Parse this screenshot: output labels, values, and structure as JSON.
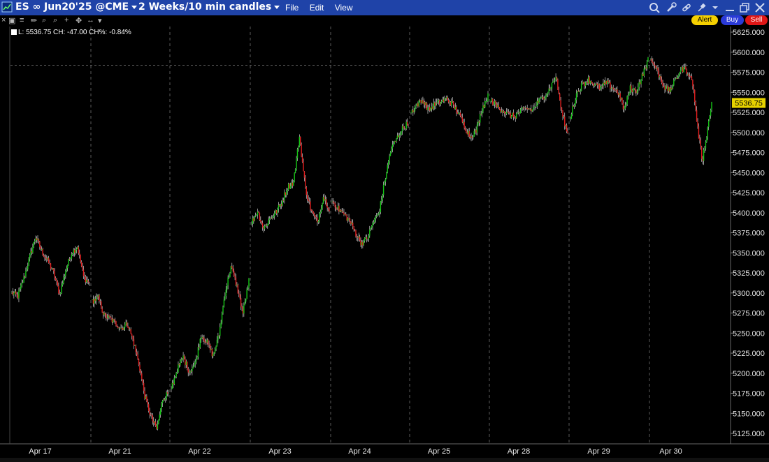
{
  "window": {
    "symbol": "ES ∞ Jun20'25 @CME",
    "timeframe": "2 Weeks/10 min candles",
    "menu": [
      "File",
      "Edit",
      "View"
    ]
  },
  "toolbar": {
    "alert_label": "Alert",
    "buy_label": "Buy",
    "sell_label": "Sell",
    "icons": [
      "crosshair-icon",
      "wrench-icon",
      "link-icon",
      "pin-icon",
      "minimize-icon",
      "restore-icon",
      "close-icon"
    ]
  },
  "readout": "L: 5536.75 CH: -47.00 CH%: -0.84%",
  "colors": {
    "up": "#14c814",
    "down": "#e41e1e",
    "background": "#000000",
    "grid": "#5a5a5a",
    "last_price_tag": "#e6d200"
  },
  "chart_data": {
    "type": "candlestick",
    "ylim": [
      5112,
      5632
    ],
    "y_ticks": [
      5125,
      5150,
      5175,
      5200,
      5225,
      5250,
      5275,
      5300,
      5325,
      5350,
      5375,
      5400,
      5425,
      5450,
      5475,
      5500,
      5525,
      5550,
      5575,
      5600,
      5625
    ],
    "x_labels": [
      "Apr 17",
      "Apr 21",
      "Apr 22",
      "Apr 23",
      "Apr 24",
      "Apr 25",
      "Apr 28",
      "Apr 29",
      "Apr 30"
    ],
    "last_price": 5536.75,
    "prev_close_reference": 5583.75,
    "sessions": [
      {
        "date": "Apr 17",
        "path": [
          5300,
          5296,
          5318,
          5345,
          5370,
          5352,
          5340,
          5325,
          5298,
          5328,
          5350,
          5358,
          5320,
          5312
        ]
      },
      {
        "date": "Apr 21",
        "path": [
          5290,
          5294,
          5272,
          5268,
          5262,
          5256,
          5262,
          5240,
          5210,
          5170,
          5146,
          5130,
          5168,
          5176
        ]
      },
      {
        "date": "Apr 22",
        "path": [
          5182,
          5205,
          5220,
          5202,
          5212,
          5248,
          5238,
          5222,
          5248,
          5300,
          5333,
          5308,
          5275,
          5315
        ]
      },
      {
        "date": "Apr 23",
        "path": [
          5388,
          5402,
          5380,
          5392,
          5400,
          5412,
          5432,
          5438,
          5495,
          5430,
          5402,
          5388,
          5420,
          5405
        ]
      },
      {
        "date": "Apr 24",
        "path": [
          5415,
          5405,
          5398,
          5390,
          5375,
          5362,
          5368,
          5388,
          5400,
          5440,
          5478,
          5492,
          5505,
          5512
        ]
      },
      {
        "date": "Apr 25",
        "path": [
          5525,
          5535,
          5540,
          5528,
          5535,
          5538,
          5542,
          5535,
          5524,
          5508,
          5495,
          5502,
          5530,
          5545
        ]
      },
      {
        "date": "Apr 28",
        "path": [
          5540,
          5533,
          5528,
          5522,
          5520,
          5526,
          5530,
          5528,
          5538,
          5545,
          5555,
          5570,
          5525,
          5498
        ]
      },
      {
        "date": "Apr 29",
        "path": [
          5520,
          5548,
          5560,
          5566,
          5560,
          5555,
          5562,
          5556,
          5550,
          5528,
          5555,
          5552,
          5570,
          5590
        ]
      },
      {
        "date": "Apr 30",
        "path": [
          5590,
          5582,
          5568,
          5556,
          5552,
          5562,
          5575,
          5580,
          5575,
          5560,
          5505,
          5465,
          5500,
          5537
        ]
      }
    ]
  }
}
